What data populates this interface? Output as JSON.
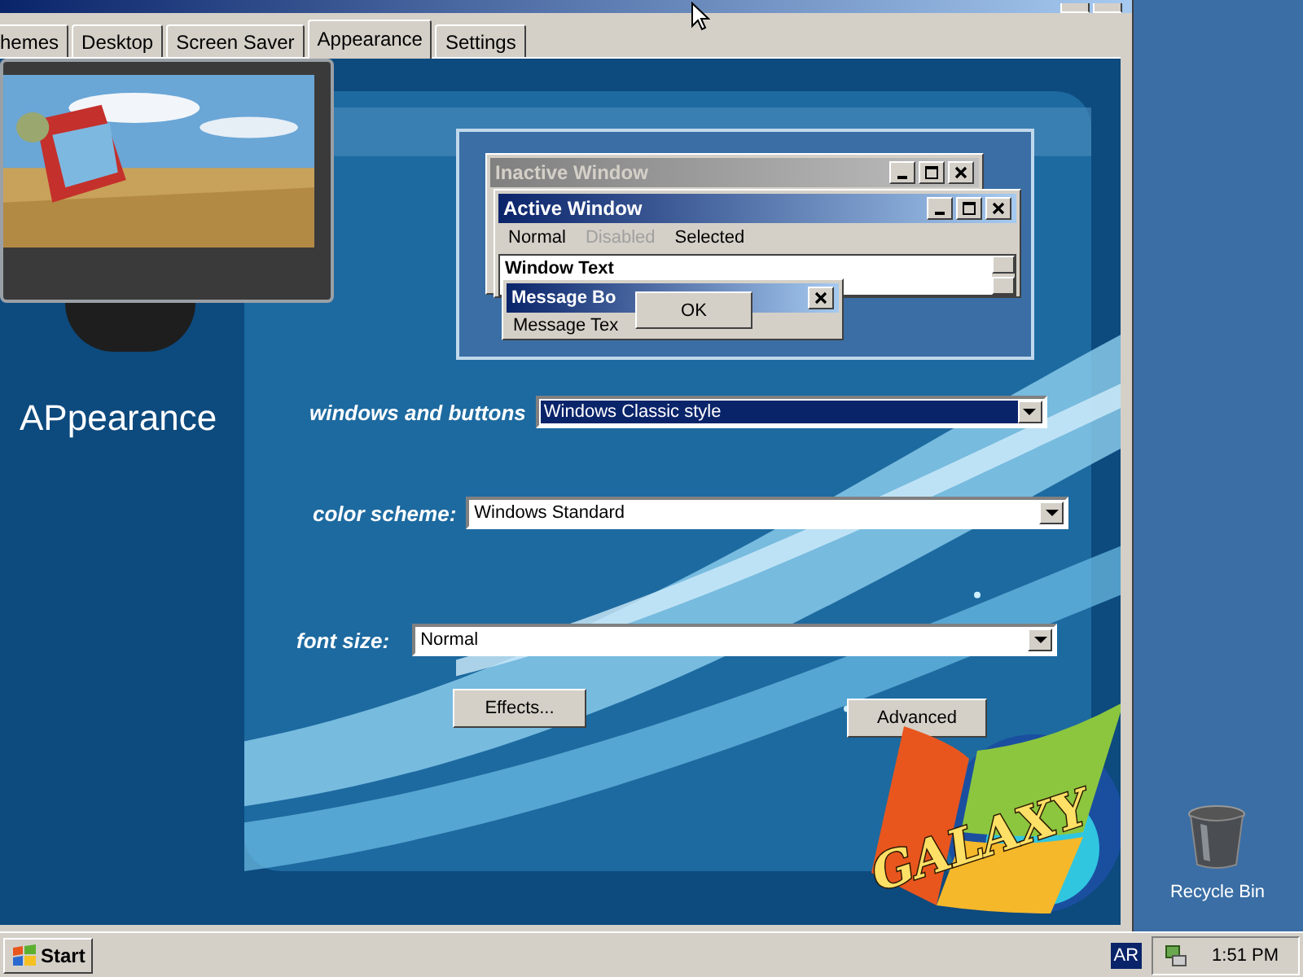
{
  "dialog": {
    "tabs": [
      {
        "label": "hemes",
        "selected": false
      },
      {
        "label": "Desktop",
        "selected": false
      },
      {
        "label": "Screen Saver",
        "selected": false
      },
      {
        "label": "Appearance",
        "selected": true
      },
      {
        "label": "Settings",
        "selected": false
      }
    ]
  },
  "preview": {
    "inactive_title": "Inactive Window",
    "active_title": "Active Window",
    "menu": [
      {
        "label": "Normal",
        "disabled": false
      },
      {
        "label": "Disabled",
        "disabled": true
      },
      {
        "label": "Selected",
        "disabled": false
      }
    ],
    "window_text": "Window Text",
    "message_title": "Message Bo",
    "message_text": "Message Tex",
    "ok": "OK"
  },
  "page_title": "APpearance",
  "fields": [
    {
      "label": "windows and buttons",
      "value": "Windows Classic style",
      "focused": true
    },
    {
      "label": "color scheme:",
      "value": "Windows Standard",
      "focused": false
    },
    {
      "label": "font size:",
      "value": "Normal",
      "focused": false
    }
  ],
  "buttons": [
    "Effects...",
    "Advanced"
  ],
  "logo": "GALAXY",
  "desktop_icons": [
    {
      "label": "Recycle Bin"
    }
  ],
  "taskbar": {
    "start": "Start",
    "language": "AR",
    "clock": "1:51 PM"
  }
}
